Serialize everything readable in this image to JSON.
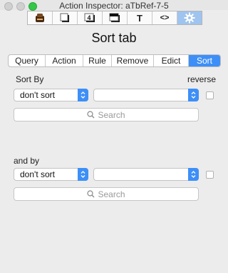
{
  "window": {
    "title": "Action Inspector: aTbRef-7-5"
  },
  "toolbar": {
    "buttons": [
      {
        "name": "stamp",
        "glyph": "◙"
      },
      {
        "name": "note",
        "glyph": "▢"
      },
      {
        "name": "number",
        "glyph": "4"
      },
      {
        "name": "table",
        "glyph": "▬"
      },
      {
        "name": "text",
        "glyph": "T"
      },
      {
        "name": "code",
        "glyph": "<>"
      },
      {
        "name": "gear",
        "glyph": "⚙"
      }
    ],
    "selected_color": "#9fc4ef"
  },
  "page": {
    "title": "Sort tab"
  },
  "tabs": {
    "items": [
      "Query",
      "Action",
      "Rule",
      "Remove",
      "Edict",
      "Sort"
    ],
    "active": "Sort",
    "accent": "#3d8ff7"
  },
  "sort_by": {
    "label": "Sort By",
    "reverse_label": "reverse",
    "primary_value": "don't sort",
    "secondary_value": "",
    "search_placeholder": "Search",
    "reverse_checked": false
  },
  "and_by": {
    "label": "and by",
    "primary_value": "don't sort",
    "secondary_value": "",
    "search_placeholder": "Search",
    "reverse_checked": false
  }
}
